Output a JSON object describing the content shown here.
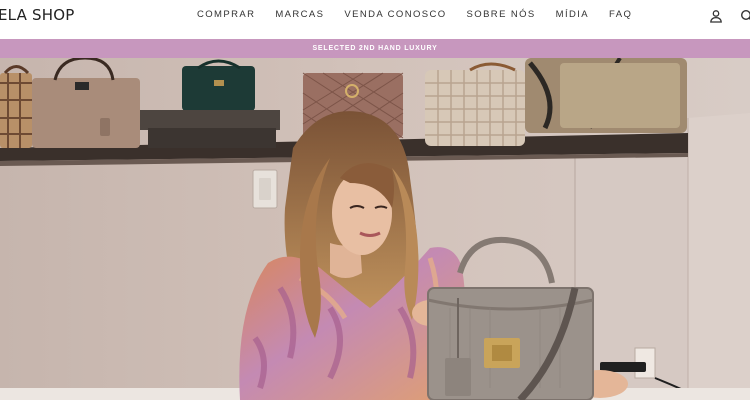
{
  "header": {
    "logo": "ELA SHOP",
    "nav": [
      "COMPRAR",
      "MARCAS",
      "VENDA CONOSCO",
      "SOBRE NÓS",
      "MÍDIA",
      "FAQ"
    ],
    "icons": [
      "account-icon",
      "search-icon"
    ]
  },
  "announcement": {
    "text": "SELECTED 2ND HAND LUXURY",
    "background": "#c797be"
  },
  "hero": {
    "image": "woman holding a taupe leather handbag in front of a shelf of designer bags"
  }
}
